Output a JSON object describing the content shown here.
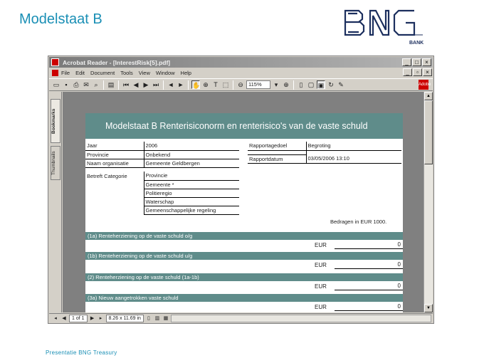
{
  "slide": {
    "title": "Modelstaat B",
    "footer": "Presentatie BNG Treasury",
    "logo_text": "BNG",
    "logo_sub": "BANK"
  },
  "window": {
    "title": "Acrobat Reader - [InterestRisk[5].pdf]",
    "menu": [
      "File",
      "Edit",
      "Document",
      "Tools",
      "View",
      "Window",
      "Help"
    ],
    "zoom": "115%",
    "side_tabs": [
      "Bookmarks",
      "Thumbnails"
    ]
  },
  "document": {
    "header": "Modelstaat B Renterisiconorm en renterisico's van de vaste schuld",
    "form_left": [
      {
        "label": "Jaar",
        "value": "2006"
      },
      {
        "label": "Provincie",
        "value": "Onbekend"
      },
      {
        "label": "Naam organisatie",
        "value": "Gemeente Geldbergen"
      }
    ],
    "form_right": [
      {
        "label": "Rapportagedoel",
        "value": "Begroting"
      },
      {
        "label": "Rapportdatum",
        "value": "03/05/2006 13:10"
      }
    ],
    "categorie": {
      "label": "Betreft Categorie",
      "options": [
        "Provincie",
        "Gemeente *",
        "Politieregio",
        "Waterschap",
        "Gemeenschappelijke regeling"
      ]
    },
    "bedragen": "Bedragen in EUR 1000.",
    "sections": [
      {
        "label": "(1a) Renteherziening op de vaste schuld o/g",
        "currency": "EUR",
        "value": "0"
      },
      {
        "label": "(1b) Renteherziening op de vaste schuld u/g",
        "currency": "EUR",
        "value": "0"
      },
      {
        "label": "(2) Renteherziening op de vaste schuld (1a-1b)",
        "currency": "EUR",
        "value": "0"
      },
      {
        "label": "(3a) Nieuw aangetrokken vaste schuld",
        "currency": "EUR",
        "value": "0"
      }
    ]
  },
  "status": {
    "page": "1 of 1",
    "size": "8.26 x 11.69 in"
  }
}
